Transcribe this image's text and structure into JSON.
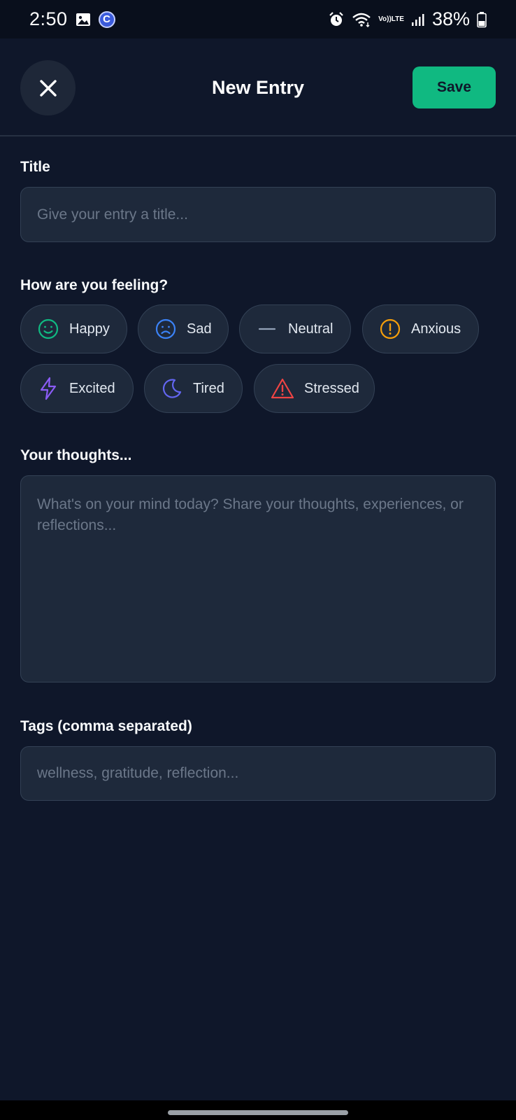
{
  "status_bar": {
    "time": "2:50",
    "battery": "38%",
    "volte_top": "Vo))",
    "volte_bottom": "LTE",
    "app_badge": "C"
  },
  "header": {
    "title": "New Entry",
    "save_label": "Save"
  },
  "title_field": {
    "label": "Title",
    "placeholder": "Give your entry a title..."
  },
  "mood": {
    "label": "How are you feeling?",
    "options": [
      {
        "label": "Happy",
        "icon": "smile-icon",
        "color": "#10b981"
      },
      {
        "label": "Sad",
        "icon": "frown-icon",
        "color": "#3b82f6"
      },
      {
        "label": "Neutral",
        "icon": "minus-icon",
        "color": "#94a3b8"
      },
      {
        "label": "Anxious",
        "icon": "alert-circle-icon",
        "color": "#f59e0b"
      },
      {
        "label": "Excited",
        "icon": "zap-icon",
        "color": "#8b5cf6"
      },
      {
        "label": "Tired",
        "icon": "moon-icon",
        "color": "#6366f1"
      },
      {
        "label": "Stressed",
        "icon": "alert-triangle-icon",
        "color": "#ef4444"
      }
    ]
  },
  "thoughts_field": {
    "label": "Your thoughts...",
    "placeholder": "What's on your mind today? Share your thoughts, experiences, or reflections..."
  },
  "tags_field": {
    "label": "Tags (comma separated)",
    "placeholder": "wellness, gratitude, reflection..."
  },
  "colors": {
    "background": "#0f172a",
    "surface": "#1e293b",
    "accent": "#10b981"
  }
}
